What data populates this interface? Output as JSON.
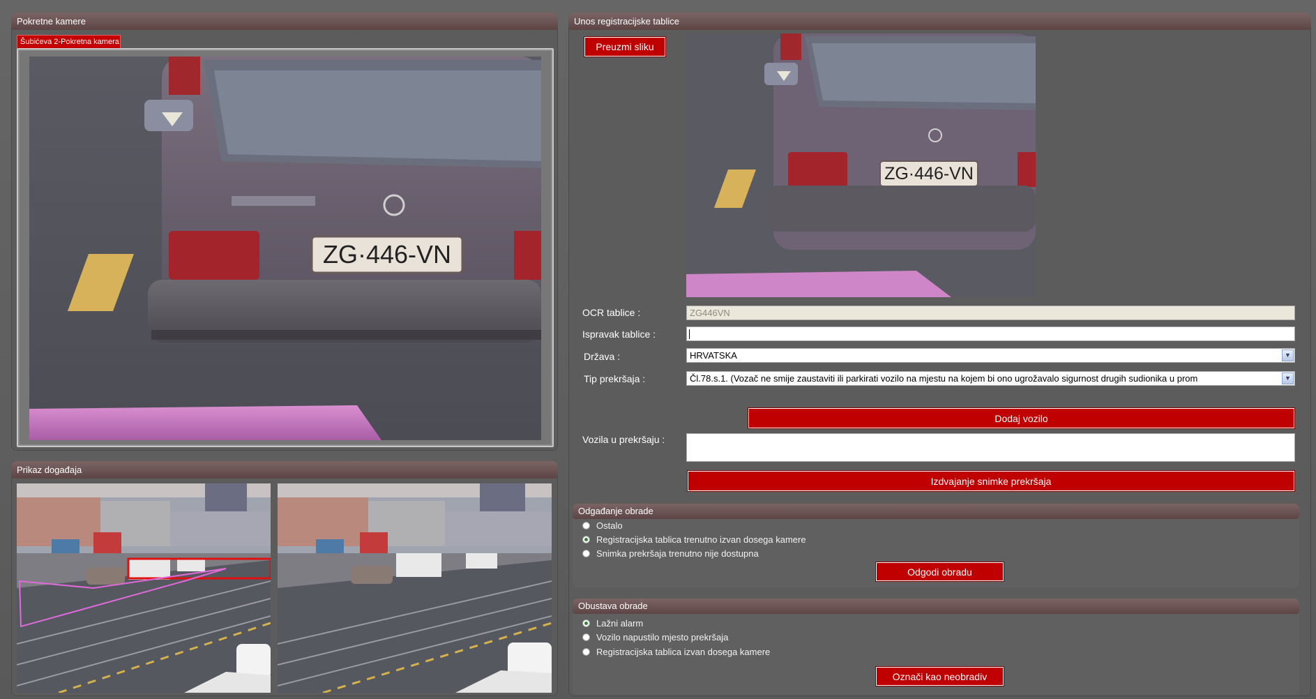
{
  "left_camera": {
    "title": "Pokretne kamere",
    "tab_label": "Šubićeva 2-Pokretna kamera",
    "plate_text": "ZG·446-VN"
  },
  "events": {
    "title": "Prikaz događaja"
  },
  "plate_entry": {
    "title": "Unos registracijske tablice",
    "fetch_button": "Preuzmi sliku",
    "crop_plate_text": "ZG·446-VN",
    "ocr_label": "OCR tablice :",
    "ocr_value": "ZG446VN",
    "correction_label": "Ispravak tablice :",
    "correction_value": "",
    "country_label": "Država :",
    "country_value": "HRVATSKA",
    "violation_label": "Tip prekršaja :",
    "violation_value": "Čl.78.s.1. (Vozač ne smije zaustaviti ili parkirati vozilo na mjestu na kojem bi ono ugrožavalo sigurnost drugih sudionika u prom",
    "add_vehicle_button": "Dodaj vozilo",
    "vehicles_label": "Vozila u prekršaju :",
    "extract_button": "Izdvajanje snimke prekršaja"
  },
  "postpone": {
    "title": "Odgađanje obrade",
    "options": [
      {
        "label": "Ostalo",
        "selected": false
      },
      {
        "label": "Registracijska tablica trenutno izvan dosega kamere",
        "selected": true
      },
      {
        "label": "Snimka prekršaja trenutno nije dostupna",
        "selected": false
      }
    ],
    "button": "Odgodi obradu"
  },
  "cancel": {
    "title": "Obustava obrade",
    "options": [
      {
        "label": "Lažni alarm",
        "selected": true
      },
      {
        "label": "Vozilo napustilo mjesto prekršaja",
        "selected": false
      },
      {
        "label": "Registracijska tablica izvan dosega kamere",
        "selected": false
      }
    ],
    "button": "Označi kao neobradiv"
  },
  "colors": {
    "accent_red": "#c00000",
    "header_brown": "#6e5454",
    "panel_gray": "#5c5c5c"
  }
}
